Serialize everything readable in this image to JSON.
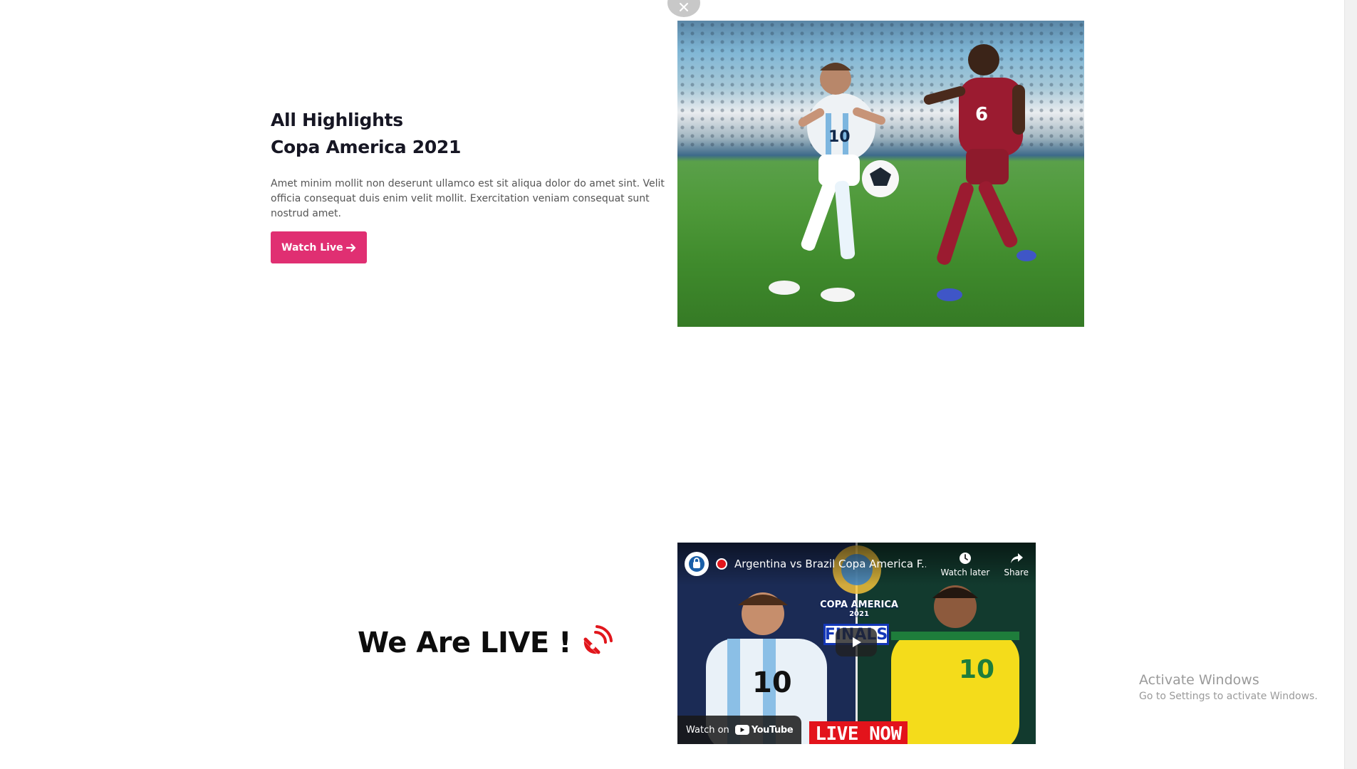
{
  "hero": {
    "title_line1": "All Highlights",
    "title_line2": "Copa America 2021",
    "description": "Amet minim mollit non deserunt ullamco est sit aliqua dolor do amet sint. Velit officia consequat duis enim velit mollit. Exercitation veniam consequat sunt nostrud amet.",
    "cta_label": "Watch Live",
    "cta_icon": "arrow-right-icon",
    "cta_color": "#e02f72"
  },
  "live": {
    "heading": "We Are LIVE !",
    "icon": "satellite-dish-icon",
    "icon_color": "#e1161c"
  },
  "video": {
    "title": "Argentina vs Brazil Copa America F...",
    "watch_later_label": "Watch later",
    "share_label": "Share",
    "watch_on_label": "Watch on",
    "youtube_label": "YouTube",
    "overlay_tournament": "COPA AMERICA",
    "overlay_year": "2021",
    "overlay_finals": "FINALS",
    "overlay_live_now": "LIVE NOW"
  },
  "system": {
    "activate_title": "Activate Windows",
    "activate_sub": "Go to Settings to activate Windows."
  }
}
